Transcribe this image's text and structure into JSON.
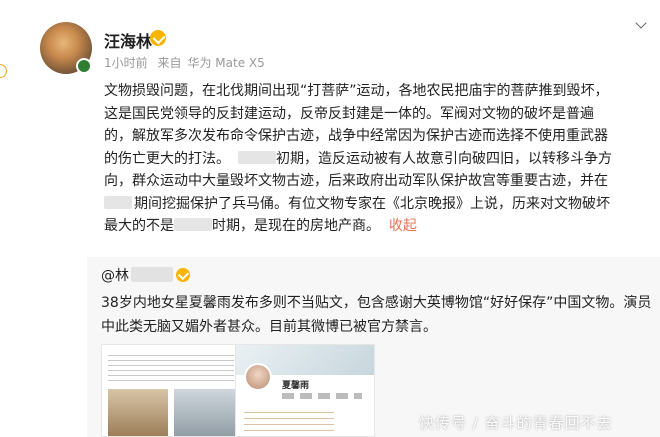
{
  "post": {
    "username": "汪海林",
    "time": "1小时前",
    "source_prefix": "来自",
    "device": "华为 Mate X5",
    "body_lines": [
      "文物损毁问题，在北伐期间出现“打菩萨”运动，各地农民把庙宇的菩萨推到毁坏，",
      "这是国民党领导的反封建运动，反帝反封建是一体的。军阀对文物的破坏是普遍",
      "的，解放军多次发布命令保护古迹，战争中经常因为保护古迹而选择不使用重武器",
      "的伤亡更大的打法。",
      "初期，造反运动被有人故意引向破四旧，以转移斗争方",
      "向，群众运动中大量毁坏文物古迹，后来政府出动军队保护故宫等重要古迹，并在",
      "期间挖掘保护了兵马俑。有位文物专家在《北京晚报》上说，历来对文物破坏",
      "最大的不是",
      "时期，是现在的房地产商。"
    ],
    "collapse_label": "收起"
  },
  "repost": {
    "user_prefix": "@林",
    "text": "38岁内地女星夏馨雨发布多则不当贴文，包含感谢大英博物馆“好好保存”中国文物。演员中此类无脑又媚外者甚众。目前其微博已被官方禁言。",
    "thumb_profile_name": "夏馨雨"
  },
  "watermark": "快传号 / 奋斗的青春回不去",
  "icons": {
    "verified": "verified-badge-icon",
    "menu": "chevron-down-icon"
  },
  "colors": {
    "link": "#eb7350",
    "verified": "#f7b500",
    "meta": "#999999"
  }
}
